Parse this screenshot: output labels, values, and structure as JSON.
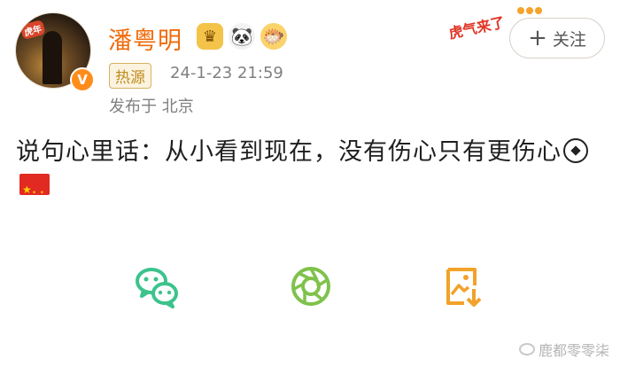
{
  "profile": {
    "username": "潘粤明",
    "avatar_sticker_text": "虎年",
    "verified_badge": "V",
    "badges": [
      "crown-badge-icon",
      "panda-badge-icon",
      "fish-badge-icon"
    ]
  },
  "post_meta": {
    "hot_tag": "热源",
    "timestamp": "24-1-23 21:59",
    "location": "发布于 北京"
  },
  "decoration": {
    "sticker_text": "虎气来了"
  },
  "actions": {
    "follow_label": "关注",
    "follow_icon": "+"
  },
  "post": {
    "text": "说句心里话：从小看到现在，没有伤心只有更伤心",
    "emojis": [
      "soccer-ball-emoji",
      "china-flag-emoji"
    ]
  },
  "share": {
    "items": [
      "wechat-share",
      "moments-share",
      "save-image"
    ],
    "wechat_color": "#3cc38c",
    "moments_color": "#7fc24b",
    "save_color": "#f2a22a"
  },
  "watermark": {
    "text": "鹿都零零柒"
  },
  "colors": {
    "username": "#f06b0b",
    "meta": "#808080",
    "text": "#1f1f1f"
  }
}
